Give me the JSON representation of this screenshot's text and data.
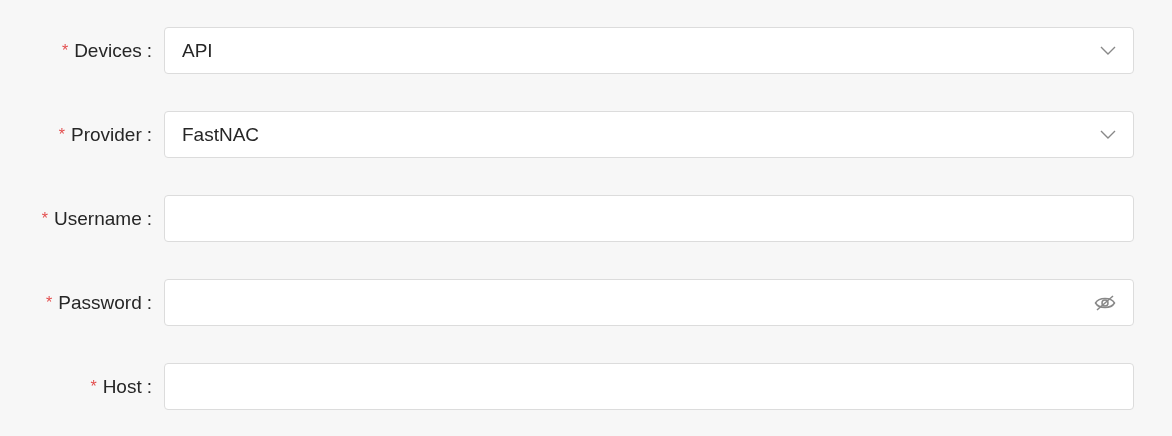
{
  "form": {
    "fields": [
      {
        "required_mark": "*",
        "label": "Devices",
        "colon": ":",
        "kind": "select",
        "value": "API"
      },
      {
        "required_mark": "*",
        "label": "Provider",
        "colon": ":",
        "kind": "select",
        "value": "FastNAC"
      },
      {
        "required_mark": "*",
        "label": "Username",
        "colon": ":",
        "kind": "text"
      },
      {
        "required_mark": "*",
        "label": "Password",
        "colon": ":",
        "kind": "password"
      },
      {
        "required_mark": "*",
        "label": "Host",
        "colon": ":",
        "kind": "text"
      }
    ]
  }
}
